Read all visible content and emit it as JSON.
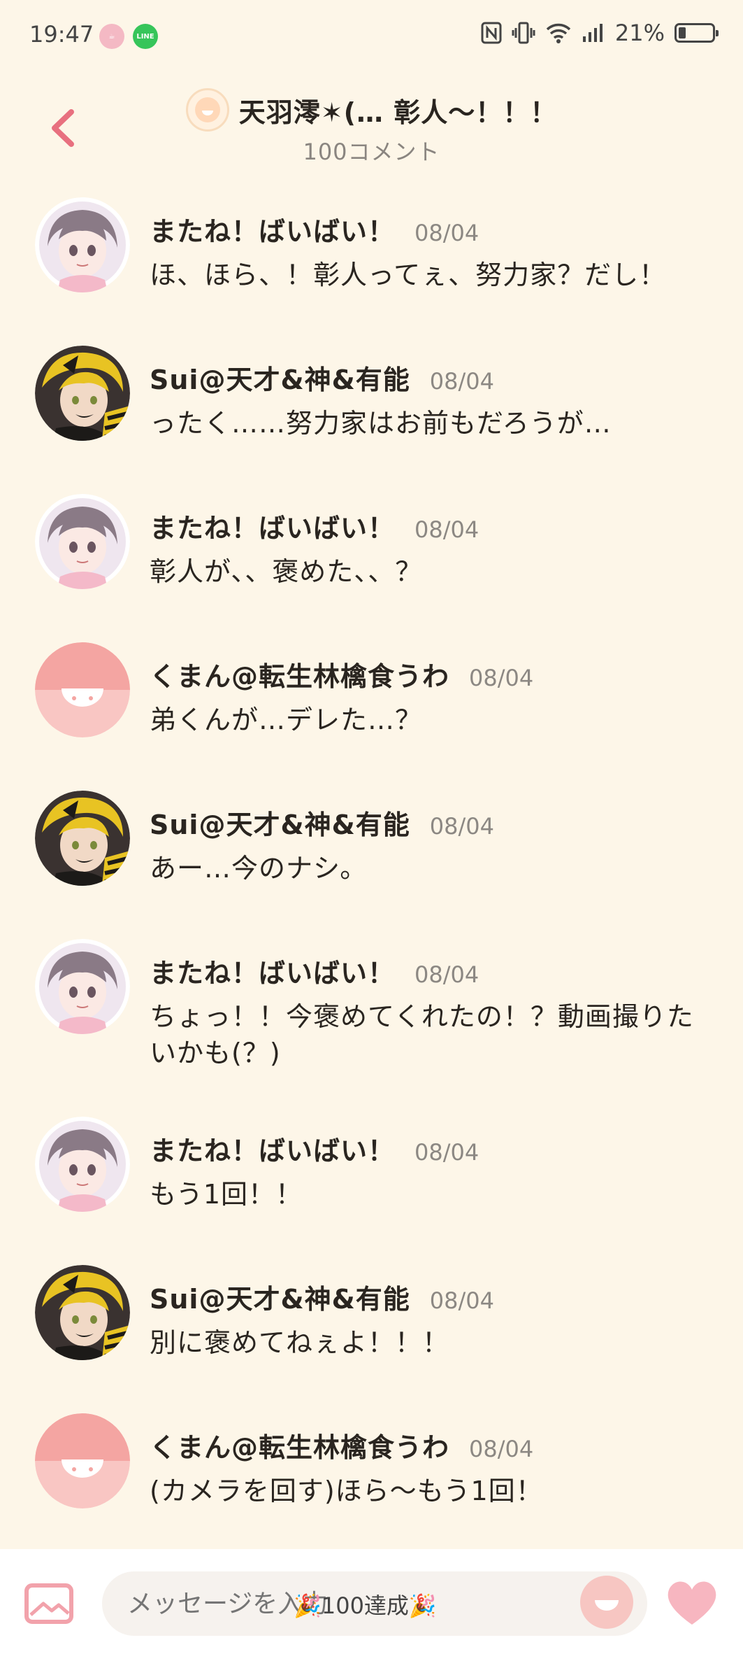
{
  "status_bar": {
    "time": "19:47",
    "battery": "21%",
    "battery_level": 0.21,
    "icons": [
      "cup-app-icon",
      "line-app-icon",
      "nfc-icon",
      "vibrate-icon",
      "wifi-icon",
      "signal-icon",
      "battery-icon"
    ]
  },
  "header": {
    "title": "天羽澪✶(… 彰人〜！！！",
    "subtitle": "100コメント"
  },
  "colors": {
    "background": "#fdf6e8",
    "accent_pink": "#e8707f",
    "date_gray": "#8c8883"
  },
  "comments": [
    {
      "name": "またね！ばいばい！",
      "date": "08/04",
      "text": "ほ、ほら、！彰人ってぇ、努力家？だし！",
      "avatar": "grey-hair-girl-avatar"
    },
    {
      "name": "Sui@天才&神&有能",
      "date": "08/04",
      "text": "ったく……努力家はお前もだろうが…",
      "avatar": "yellow-hair-boy-avatar"
    },
    {
      "name": "またね！ばいばい！",
      "date": "08/04",
      "text": "彰人が、、褒めた、、？",
      "avatar": "grey-hair-girl-avatar"
    },
    {
      "name": "くまん@転生林檎食うわ",
      "date": "08/04",
      "text": "弟くんが…デレた…？",
      "avatar": "default-smile-avatar"
    },
    {
      "name": "Sui@天才&神&有能",
      "date": "08/04",
      "text": "あー…今のナシ。",
      "avatar": "yellow-hair-boy-avatar"
    },
    {
      "name": "またね！ばいばい！",
      "date": "08/04",
      "text": "ちょっ！！今褒めてくれたの！？動画撮りたいかも(？)",
      "avatar": "grey-hair-girl-avatar"
    },
    {
      "name": "またね！ばいばい！",
      "date": "08/04",
      "text": "もう1回！！",
      "avatar": "grey-hair-girl-avatar"
    },
    {
      "name": "Sui@天才&神&有能",
      "date": "08/04",
      "text": "別に褒めてねぇよ！！！",
      "avatar": "yellow-hair-boy-avatar"
    },
    {
      "name": "くまん@転生林檎食うわ",
      "date": "08/04",
      "text": "(カメラを回す)ほら〜もう1回！",
      "avatar": "default-smile-avatar"
    }
  ],
  "composer": {
    "placeholder": "メッセージを入力",
    "badge": "🎉100達成🎉"
  }
}
